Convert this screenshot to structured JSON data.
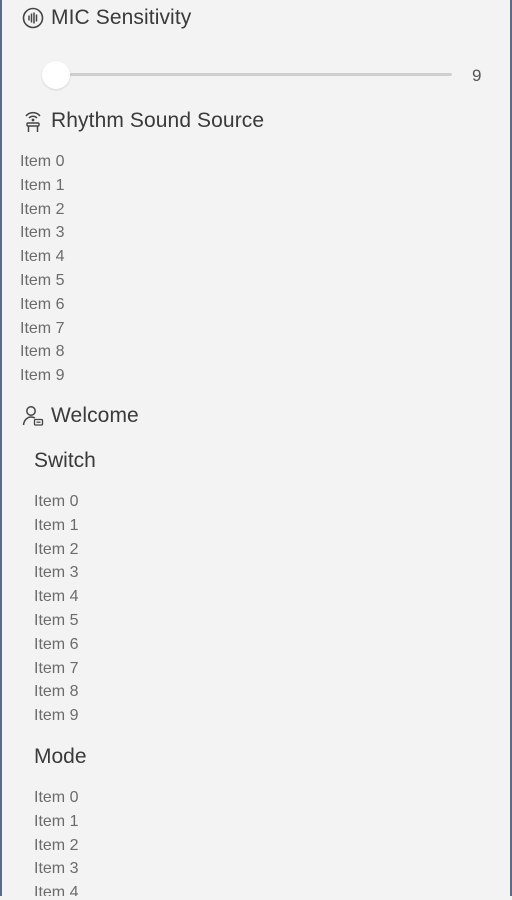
{
  "mic": {
    "title": "MIC Sensitivity",
    "icon": "mic-wave-icon",
    "slider_value": "9",
    "slider_fraction": 0.0
  },
  "rhythm": {
    "title": "Rhythm Sound Source",
    "icon": "broadcast-person-icon",
    "items": [
      "Item 0",
      "Item 1",
      "Item 2",
      "Item 3",
      "Item 4",
      "Item 5",
      "Item 6",
      "Item 7",
      "Item 8",
      "Item 9"
    ]
  },
  "welcome": {
    "title": "Welcome",
    "icon": "user-settings-icon",
    "switch": {
      "title": "Switch",
      "items": [
        "Item 0",
        "Item 1",
        "Item 2",
        "Item 3",
        "Item 4",
        "Item 5",
        "Item 6",
        "Item 7",
        "Item 8",
        "Item 9"
      ]
    },
    "mode": {
      "title": "Mode",
      "items": [
        "Item 0",
        "Item 1",
        "Item 2",
        "Item 3",
        "Item 4"
      ]
    }
  },
  "colors": {
    "background": "#f3f3f3",
    "border": "#5c6a8a",
    "track": "#cfcfcf",
    "thumb": "#ffffff"
  }
}
